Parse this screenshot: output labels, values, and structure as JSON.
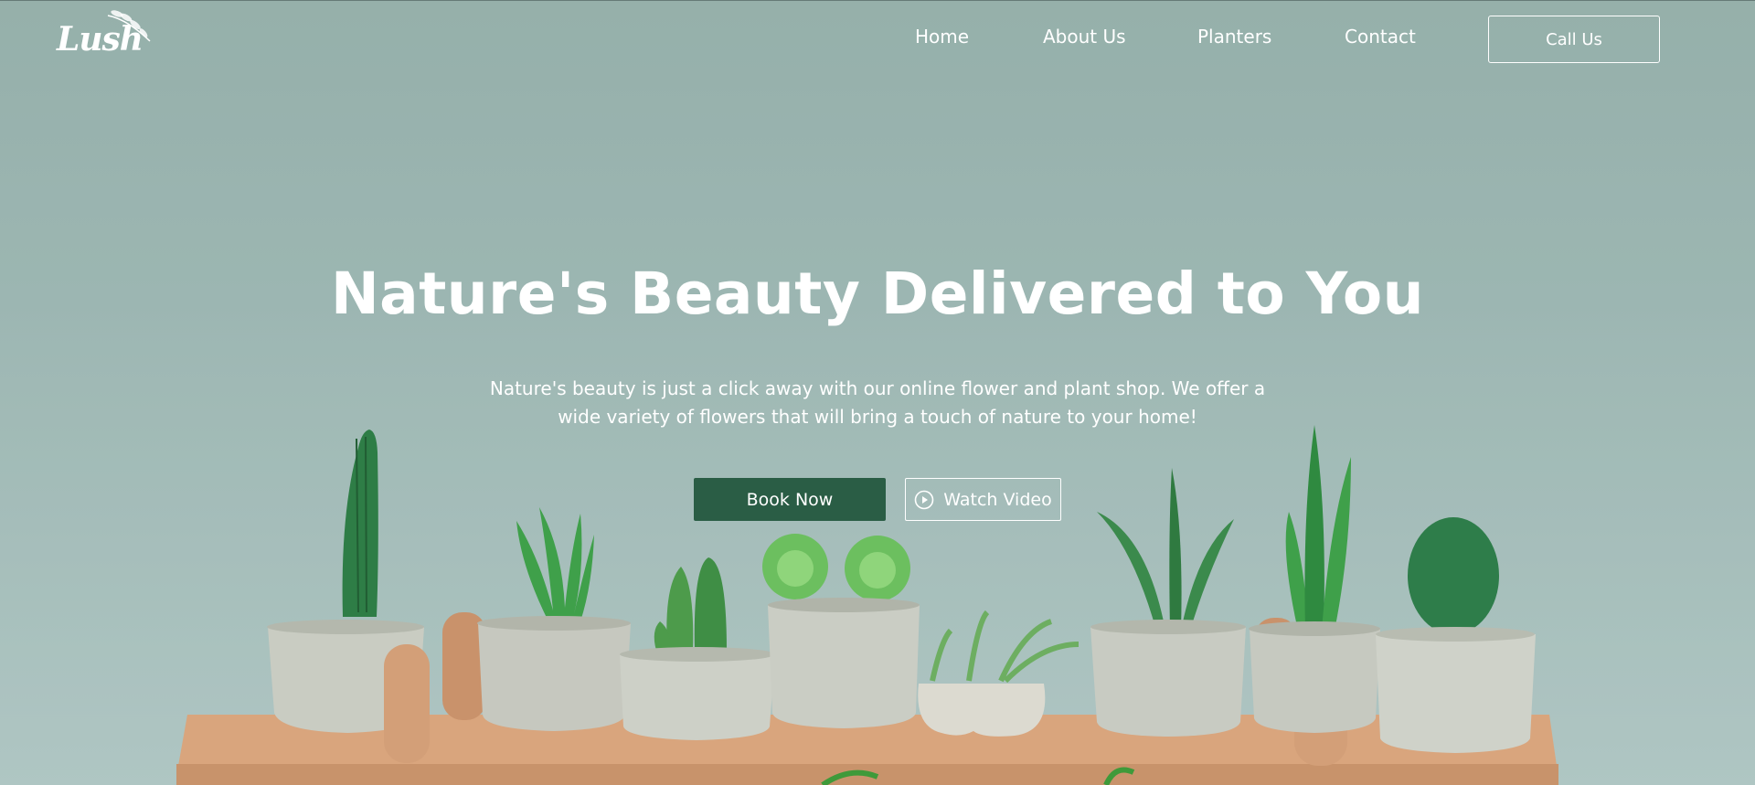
{
  "brand": {
    "logo_text": "Lush"
  },
  "nav": {
    "items": [
      {
        "label": "Home"
      },
      {
        "label": "About Us"
      },
      {
        "label": "Planters"
      },
      {
        "label": "Contact"
      }
    ],
    "cta_label": "Call Us"
  },
  "hero": {
    "title": "Nature's Beauty Delivered to You",
    "subtitle": "Nature's beauty is just a click away with our online flower and plant shop. We offer a wide variety of flowers that will bring a touch of nature to your home!",
    "primary_button": "Book Now",
    "secondary_button": "Watch Video",
    "secondary_icon": "play-circle-icon"
  },
  "colors": {
    "accent": "#2a5d45",
    "background": "#9cb5b0",
    "text": "#ffffff"
  }
}
